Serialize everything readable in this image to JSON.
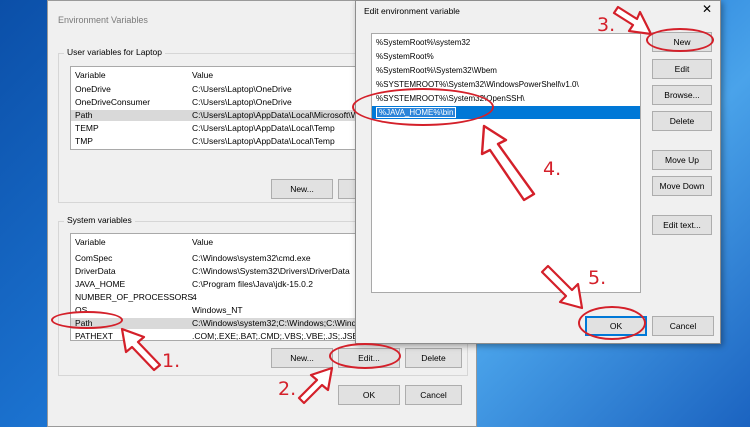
{
  "env_window": {
    "title": "Environment Variables",
    "user_group": {
      "label": "User variables for Laptop",
      "col_variable": "Variable",
      "col_value": "Value",
      "rows": [
        {
          "variable": "OneDrive",
          "value": "C:\\Users\\Laptop\\OneDrive"
        },
        {
          "variable": "OneDriveConsumer",
          "value": "C:\\Users\\Laptop\\OneDrive"
        },
        {
          "variable": "Path",
          "value": "C:\\Users\\Laptop\\AppData\\Local\\Microsoft\\W"
        },
        {
          "variable": "TEMP",
          "value": "C:\\Users\\Laptop\\AppData\\Local\\Temp"
        },
        {
          "variable": "TMP",
          "value": "C:\\Users\\Laptop\\AppData\\Local\\Temp"
        }
      ],
      "new_label": "New..."
    },
    "system_group": {
      "label": "System variables",
      "col_variable": "Variable",
      "col_value": "Value",
      "rows": [
        {
          "variable": "ComSpec",
          "value": "C:\\Windows\\system32\\cmd.exe"
        },
        {
          "variable": "DriverData",
          "value": "C:\\Windows\\System32\\Drivers\\DriverData"
        },
        {
          "variable": "JAVA_HOME",
          "value": "C:\\Program files\\Java\\jdk-15.0.2"
        },
        {
          "variable": "NUMBER_OF_PROCESSORS",
          "value": "4"
        },
        {
          "variable": "OS",
          "value": "Windows_NT"
        },
        {
          "variable": "Path",
          "value": "C:\\Windows\\system32;C:\\Windows;C:\\Windo"
        },
        {
          "variable": "PATHEXT",
          "value": ".COM;.EXE;.BAT;.CMD;.VBS;.VBE;.JS;.JSE;.WSF;"
        }
      ],
      "new_label": "New...",
      "edit_label": "Edit...",
      "delete_label": "Delete"
    },
    "ok_label": "OK",
    "cancel_label": "Cancel"
  },
  "edit_window": {
    "title": "Edit environment variable",
    "close_glyph": "✕",
    "entries": [
      "%SystemRoot%\\system32",
      "%SystemRoot%",
      "%SystemRoot%\\System32\\Wbem",
      "%SYSTEMROOT%\\System32\\WindowsPowerShell\\v1.0\\",
      "%SYSTEMROOT%\\System32\\OpenSSH\\"
    ],
    "selected_entry": "%JAVA_HOME%\\bin",
    "buttons": {
      "new": "New",
      "edit": "Edit",
      "browse": "Browse...",
      "delete": "Delete",
      "move_up": "Move Up",
      "move_down": "Move Down",
      "edit_text": "Edit text...",
      "ok": "OK",
      "cancel": "Cancel"
    }
  },
  "annotations": {
    "step1": "1.",
    "step2": "2.",
    "step3": "3.",
    "step4": "4.",
    "step5": "5.",
    "color": "#d4202a"
  }
}
